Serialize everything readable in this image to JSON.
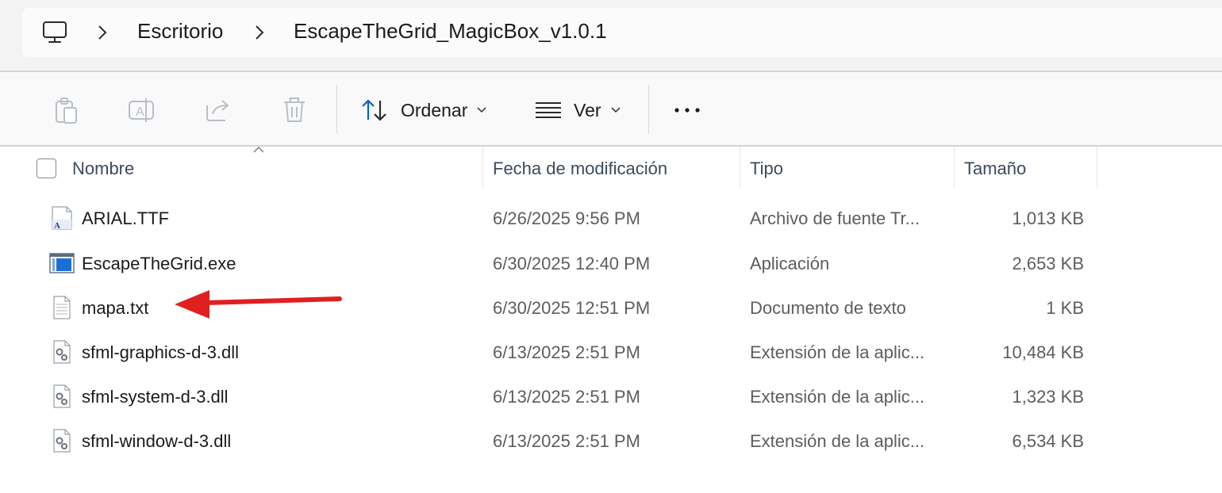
{
  "breadcrumb": {
    "root_icon": "computer-icon",
    "items": [
      "Escritorio",
      "EscapeTheGrid_MagicBox_v1.0.1"
    ]
  },
  "toolbar": {
    "icons": [
      "paste-icon",
      "rename-icon",
      "share-icon",
      "delete-icon"
    ],
    "sort_label": "Ordenar",
    "view_label": "Ver",
    "more_icon": "more-icon"
  },
  "columns": {
    "name": "Nombre",
    "date": "Fecha de modificación",
    "type": "Tipo",
    "size": "Tamaño"
  },
  "files": [
    {
      "icon": "font-file-icon",
      "name": "ARIAL.TTF",
      "date": "6/26/2025 9:56 PM",
      "type": "Archivo de fuente Tr...",
      "size": "1,013 KB"
    },
    {
      "icon": "exe-file-icon",
      "name": "EscapeTheGrid.exe",
      "date": "6/30/2025 12:40 PM",
      "type": "Aplicación",
      "size": "2,653 KB"
    },
    {
      "icon": "text-file-icon",
      "name": "mapa.txt",
      "date": "6/30/2025 12:51 PM",
      "type": "Documento de texto",
      "size": "1 KB"
    },
    {
      "icon": "dll-file-icon",
      "name": "sfml-graphics-d-3.dll",
      "date": "6/13/2025 2:51 PM",
      "type": "Extensión de la aplic...",
      "size": "10,484 KB"
    },
    {
      "icon": "dll-file-icon",
      "name": "sfml-system-d-3.dll",
      "date": "6/13/2025 2:51 PM",
      "type": "Extensión de la aplic...",
      "size": "1,323 KB"
    },
    {
      "icon": "dll-file-icon",
      "name": "sfml-window-d-3.dll",
      "date": "6/13/2025 2:51 PM",
      "type": "Extensión de la aplic...",
      "size": "6,534 KB"
    }
  ],
  "annotation": {
    "arrow_color": "#e02020",
    "target": "mapa.txt"
  },
  "colors": {
    "accent": "#0a63c9",
    "header_text": "#3b4b5c"
  }
}
